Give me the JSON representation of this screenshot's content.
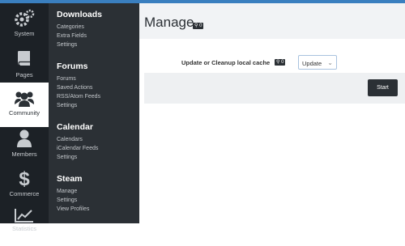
{
  "rail": {
    "items": [
      {
        "label": "System",
        "icon": "gears-icon"
      },
      {
        "label": "Pages",
        "icon": "book-icon"
      },
      {
        "label": "Community",
        "icon": "users-icon"
      },
      {
        "label": "Members",
        "icon": "user-icon"
      },
      {
        "label": "Commerce",
        "icon": "dollar-icon"
      },
      {
        "label": "Statistics",
        "icon": "chart-icon"
      }
    ],
    "active": "Community"
  },
  "menu": {
    "sections": [
      {
        "title": "Downloads",
        "links": [
          "Categories",
          "Extra Fields",
          "Settings"
        ]
      },
      {
        "title": "Forums",
        "links": [
          "Forums",
          "Saved Actions",
          "RSS/Atom Feeds",
          "Settings"
        ]
      },
      {
        "title": "Calendar",
        "links": [
          "Calendars",
          "iCalendar Feeds",
          "Settings"
        ]
      },
      {
        "title": "Steam",
        "links": [
          "Manage",
          "Settings",
          "View Profiles"
        ]
      }
    ]
  },
  "main": {
    "title": "Manage",
    "title_badge": "0",
    "field_label": "Update or Cleanup local cache",
    "field_badge": "0",
    "select_value": "Update",
    "start_label": "Start"
  },
  "colors": {
    "accent": "#3a7fbf",
    "rail_bg": "#1c2126",
    "menu_bg": "#2b3035"
  }
}
